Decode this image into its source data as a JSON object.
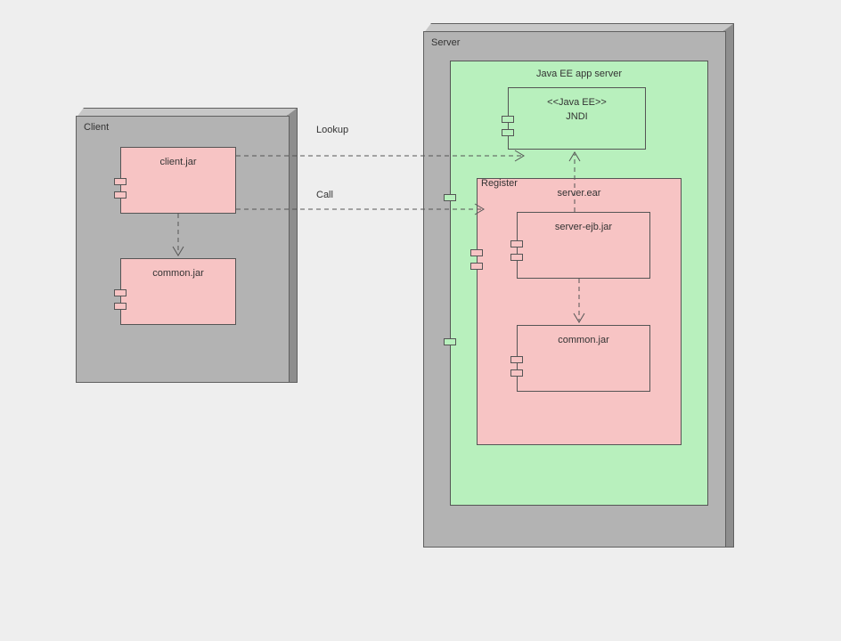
{
  "diagram": {
    "client_node": {
      "title": "Client"
    },
    "server_node": {
      "title": "Server"
    },
    "client_jar": {
      "label": "client.jar"
    },
    "client_common": {
      "label": "common.jar"
    },
    "app_server": {
      "title": "Java EE app server"
    },
    "jndi": {
      "stereotype": "<<Java EE>>",
      "label": "JNDI"
    },
    "server_ear": {
      "label": "server.ear"
    },
    "server_ejb": {
      "label": "server-ejb.jar"
    },
    "server_common": {
      "label": "common.jar"
    },
    "edges": {
      "lookup": {
        "label": "Lookup"
      },
      "call": {
        "label": "Call"
      },
      "register": {
        "label": "Register"
      }
    }
  }
}
